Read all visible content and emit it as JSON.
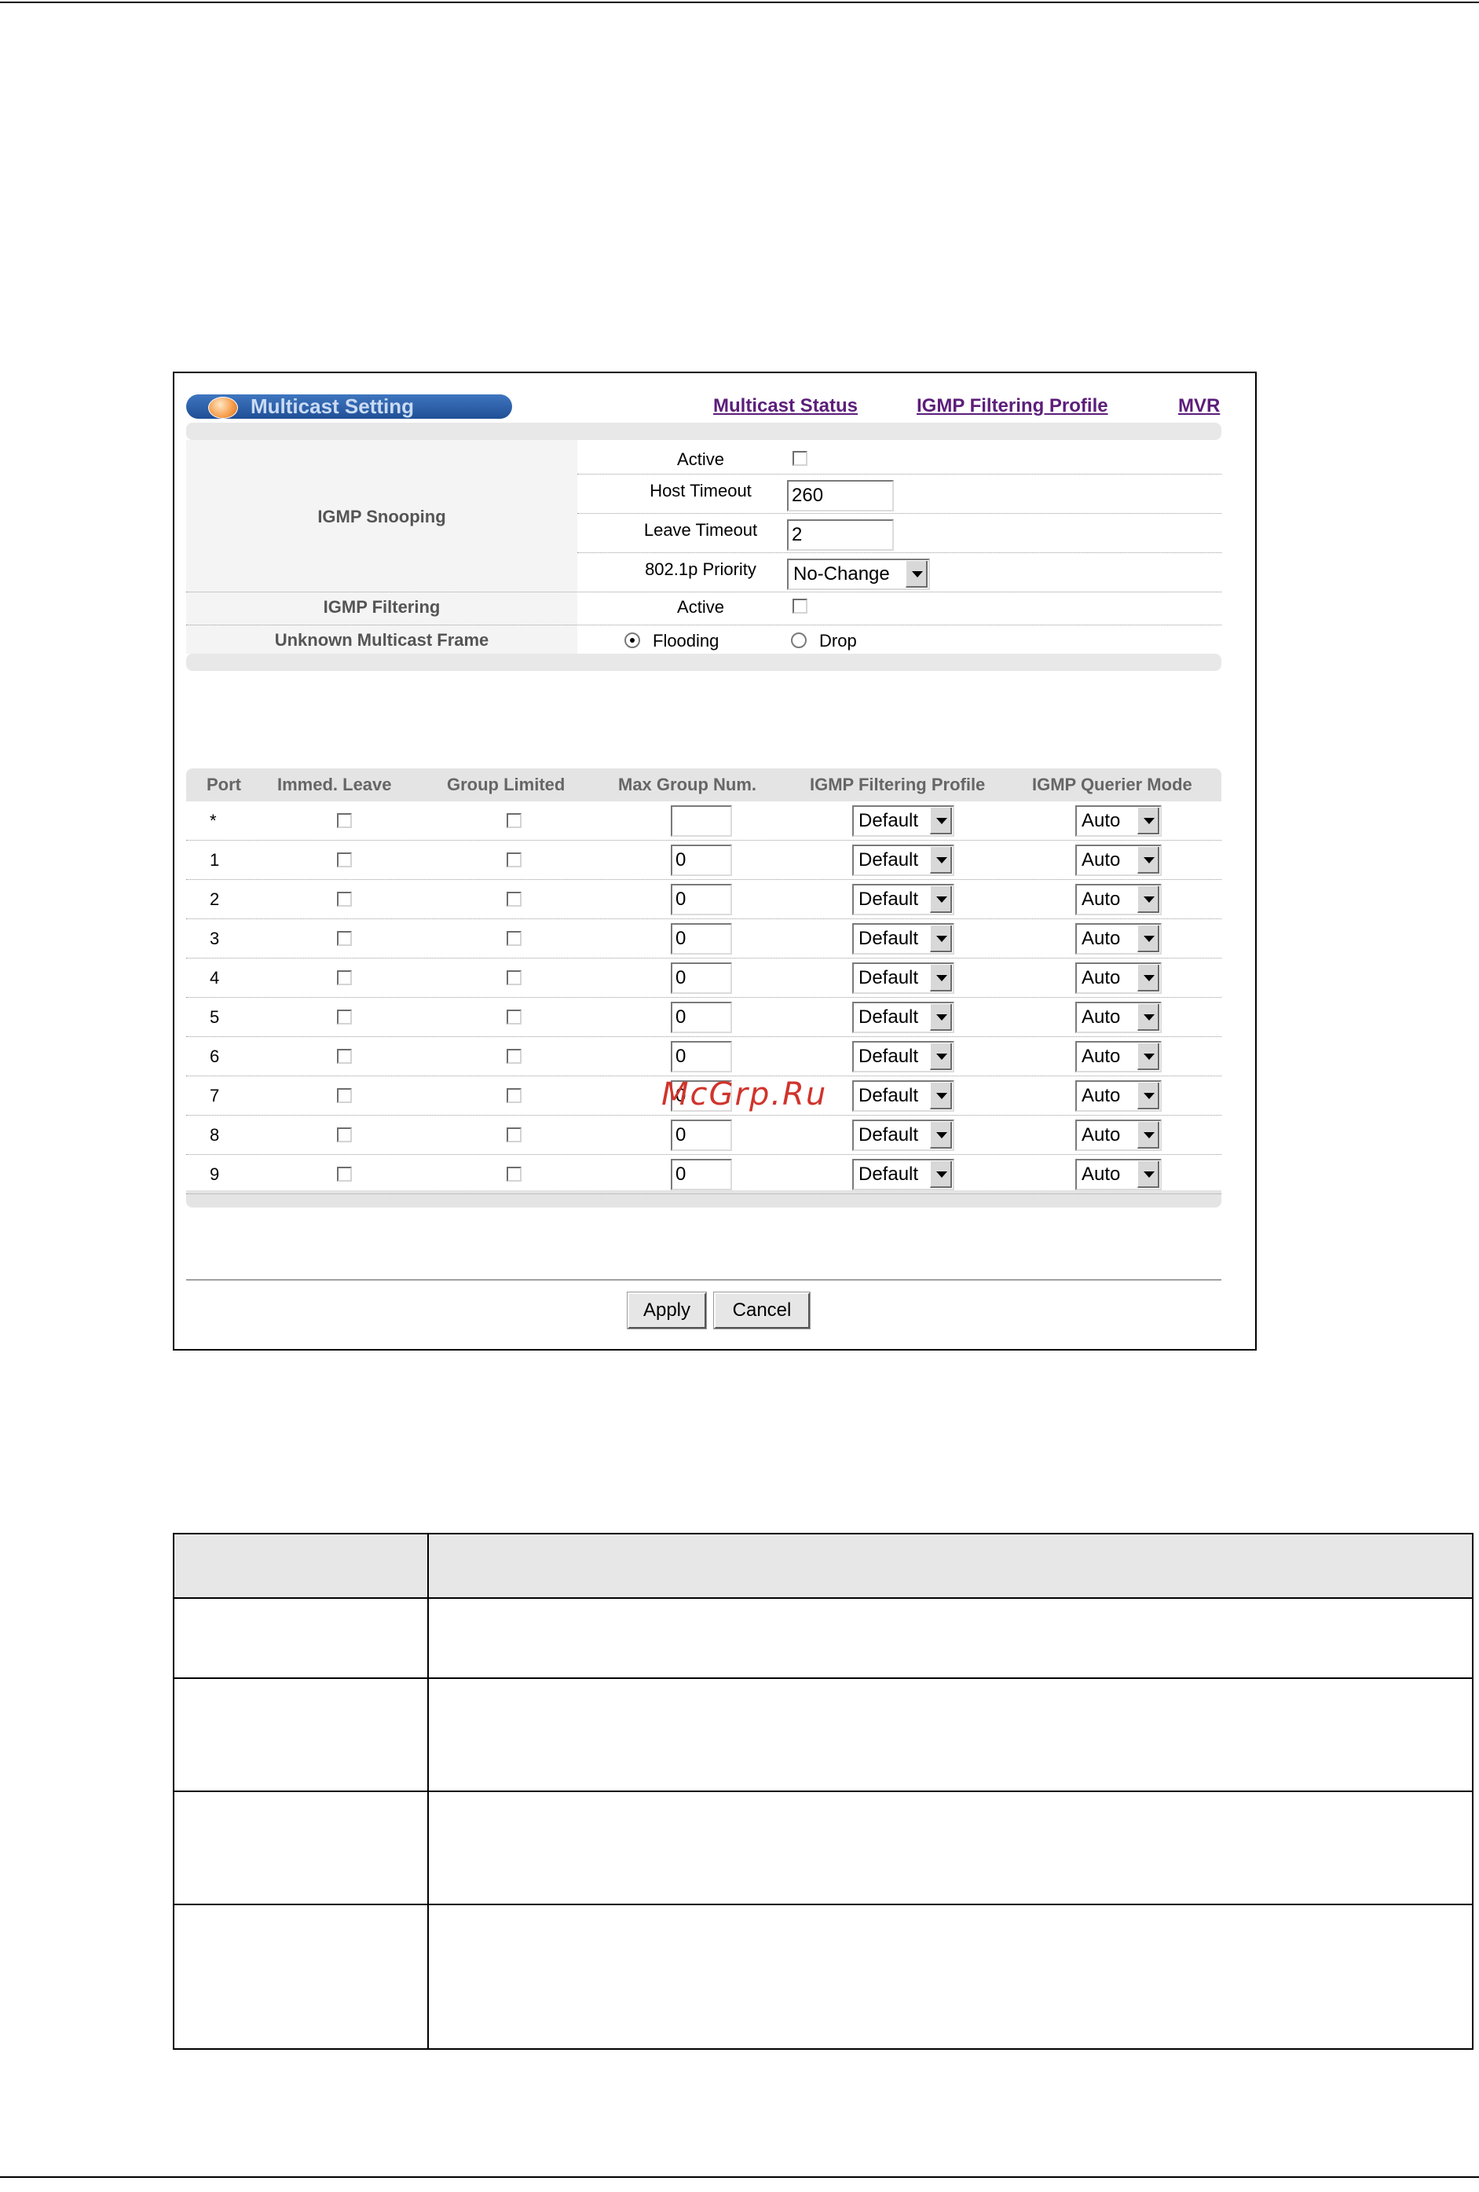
{
  "panel": {
    "title": "Multicast Setting",
    "links": [
      "Multicast Status",
      "IGMP Filtering Profile",
      "MVR"
    ]
  },
  "settings": {
    "igmp_snooping_label": "IGMP Snooping",
    "active_label": "Active",
    "active_checked": false,
    "host_timeout_label": "Host Timeout",
    "host_timeout_value": "260",
    "leave_timeout_label": "Leave Timeout",
    "leave_timeout_value": "2",
    "priority_label": "802.1p Priority",
    "priority_value": "No-Change",
    "igmp_filtering_label": "IGMP Filtering",
    "filtering_active_label": "Active",
    "filtering_active_checked": false,
    "unknown_frame_label": "Unknown Multicast Frame",
    "unknown_options": [
      "Flooding",
      "Drop"
    ],
    "unknown_selected": "Flooding"
  },
  "port_table": {
    "headers": [
      "Port",
      "Immed. Leave",
      "Group Limited",
      "Max Group Num.",
      "IGMP Filtering Profile",
      "IGMP Querier Mode"
    ],
    "rows": [
      {
        "port": "*",
        "immed_leave": false,
        "group_limited": false,
        "max_group": "",
        "profile": "Default",
        "querier": "Auto"
      },
      {
        "port": "1",
        "immed_leave": false,
        "group_limited": false,
        "max_group": "0",
        "profile": "Default",
        "querier": "Auto"
      },
      {
        "port": "2",
        "immed_leave": false,
        "group_limited": false,
        "max_group": "0",
        "profile": "Default",
        "querier": "Auto"
      },
      {
        "port": "3",
        "immed_leave": false,
        "group_limited": false,
        "max_group": "0",
        "profile": "Default",
        "querier": "Auto"
      },
      {
        "port": "4",
        "immed_leave": false,
        "group_limited": false,
        "max_group": "0",
        "profile": "Default",
        "querier": "Auto"
      },
      {
        "port": "5",
        "immed_leave": false,
        "group_limited": false,
        "max_group": "0",
        "profile": "Default",
        "querier": "Auto"
      },
      {
        "port": "6",
        "immed_leave": false,
        "group_limited": false,
        "max_group": "0",
        "profile": "Default",
        "querier": "Auto"
      },
      {
        "port": "7",
        "immed_leave": false,
        "group_limited": false,
        "max_group": "0",
        "profile": "Default",
        "querier": "Auto"
      },
      {
        "port": "8",
        "immed_leave": false,
        "group_limited": false,
        "max_group": "0",
        "profile": "Default",
        "querier": "Auto"
      },
      {
        "port": "9",
        "immed_leave": false,
        "group_limited": false,
        "max_group": "0",
        "profile": "Default",
        "querier": "Auto"
      }
    ]
  },
  "buttons": {
    "apply": "Apply",
    "cancel": "Cancel"
  },
  "watermark": "McGrp.Ru"
}
